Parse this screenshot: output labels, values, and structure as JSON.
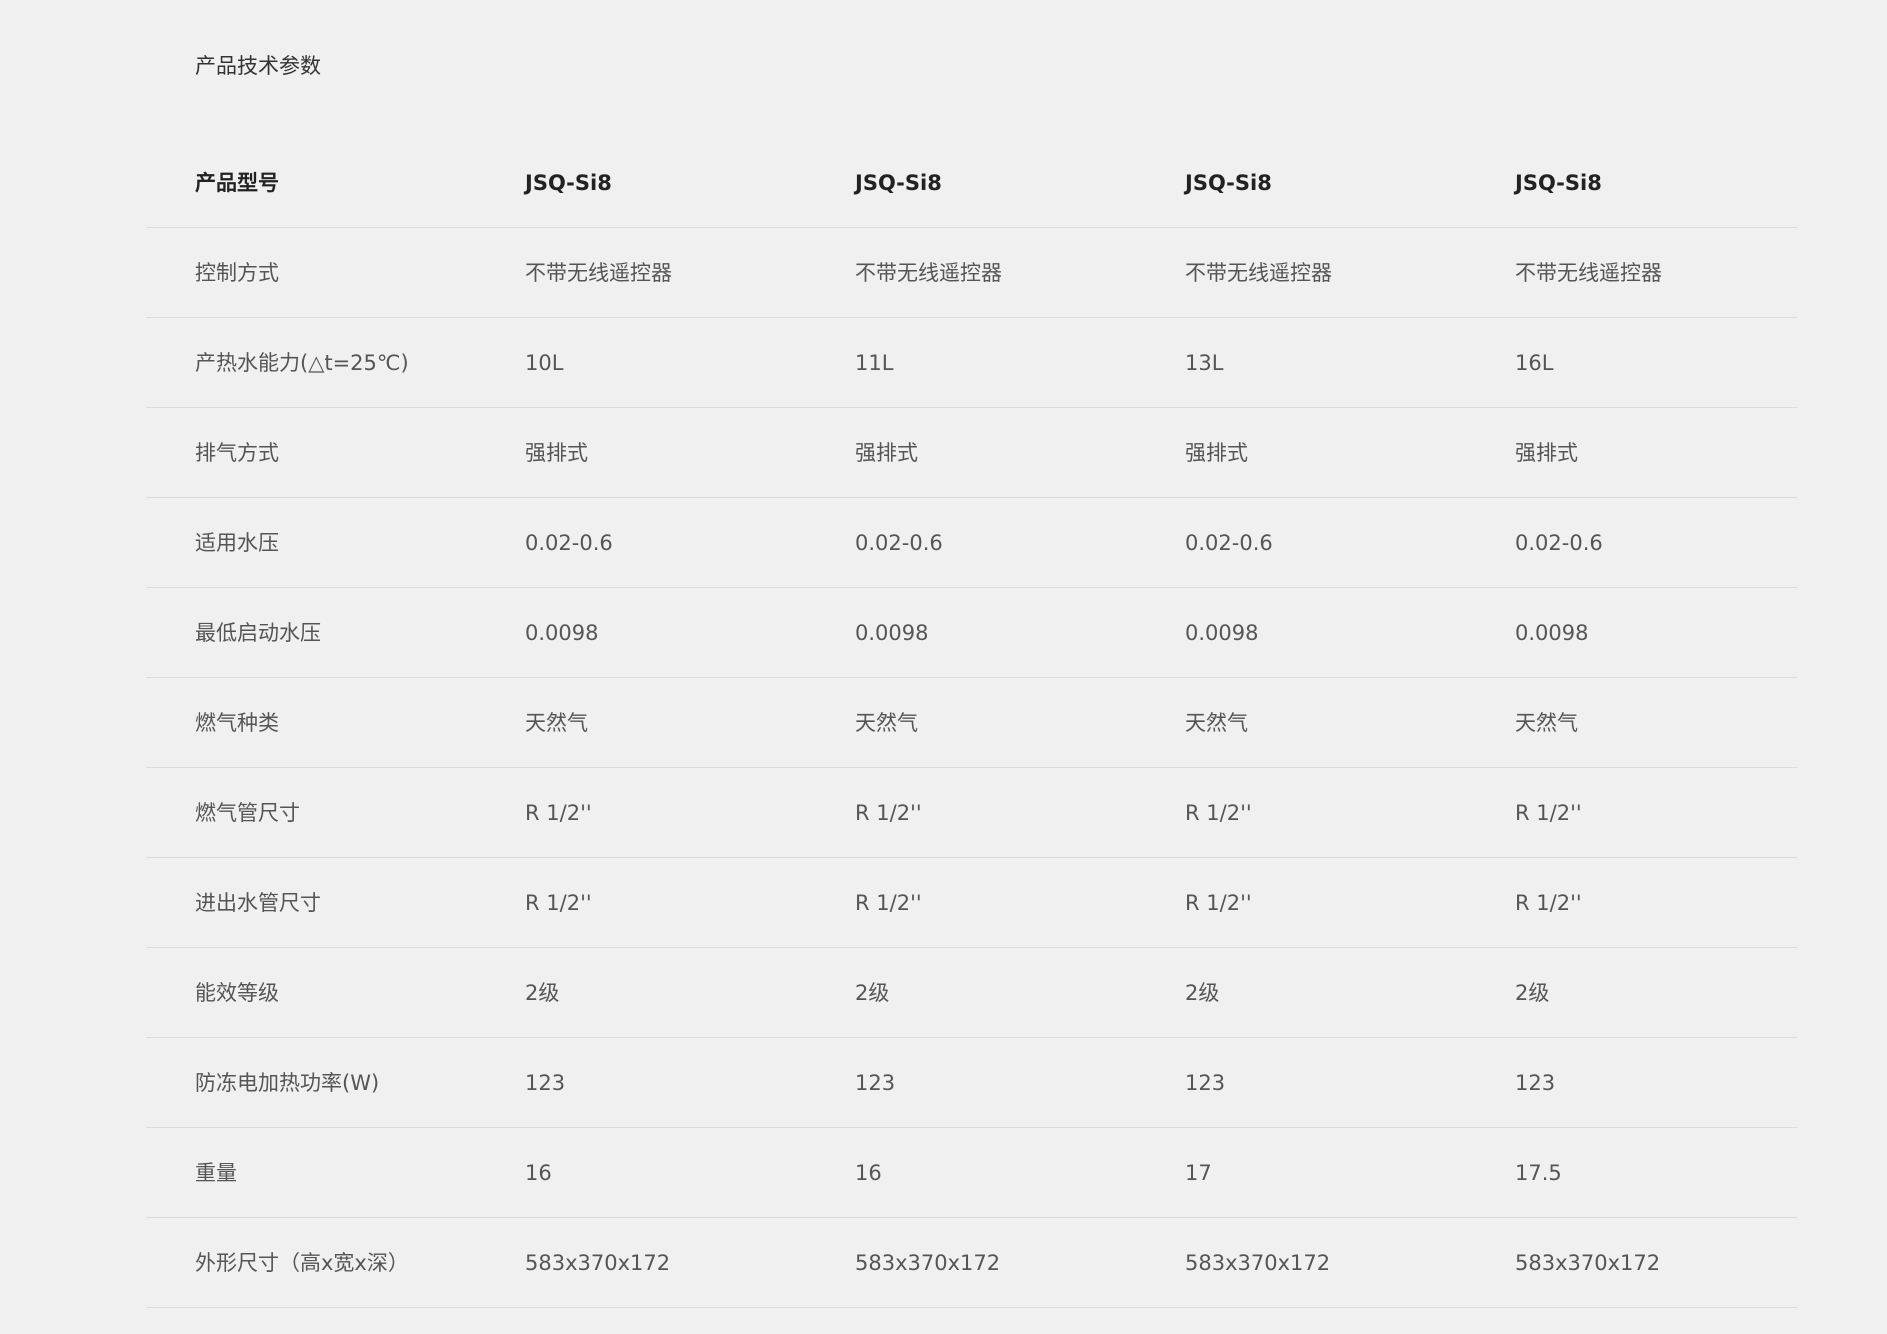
{
  "section_title": "产品技术参数",
  "table": {
    "header": {
      "label": "产品型号",
      "values": [
        "JSQ-Si8",
        "JSQ-Si8",
        "JSQ-Si8",
        "JSQ-Si8"
      ]
    },
    "rows": [
      {
        "label": "控制方式",
        "values": [
          "不带无线遥控器",
          "不带无线遥控器",
          "不带无线遥控器",
          "不带无线遥控器"
        ]
      },
      {
        "label": "产热水能力(△t=25℃)",
        "values": [
          "10L",
          "11L",
          "13L",
          "16L"
        ]
      },
      {
        "label": "排气方式",
        "values": [
          "强排式",
          "强排式",
          "强排式",
          "强排式"
        ]
      },
      {
        "label": "适用水压",
        "values": [
          "0.02-0.6",
          "0.02-0.6",
          "0.02-0.6",
          "0.02-0.6"
        ]
      },
      {
        "label": "最低启动水压",
        "values": [
          "0.0098",
          "0.0098",
          "0.0098",
          "0.0098"
        ]
      },
      {
        "label": "燃气种类",
        "values": [
          "天然气",
          "天然气",
          "天然气",
          "天然气"
        ]
      },
      {
        "label": "燃气管尺寸",
        "values": [
          "R 1/2''",
          "R 1/2''",
          "R 1/2''",
          "R 1/2''"
        ]
      },
      {
        "label": "进出水管尺寸",
        "values": [
          "R 1/2''",
          "R 1/2''",
          "R 1/2''",
          "R 1/2''"
        ]
      },
      {
        "label": "能效等级",
        "values": [
          "2级",
          "2级",
          "2级",
          "2级"
        ]
      },
      {
        "label": "防冻电加热功率(W)",
        "values": [
          "123",
          "123",
          "123",
          "123"
        ]
      },
      {
        "label": "重量",
        "values": [
          "16",
          "16",
          "17",
          "17.5"
        ]
      },
      {
        "label": "外形尺寸（高x宽x深）",
        "values": [
          "583x370x172",
          "583x370x172",
          "583x370x172",
          "583x370x172"
        ]
      }
    ]
  }
}
